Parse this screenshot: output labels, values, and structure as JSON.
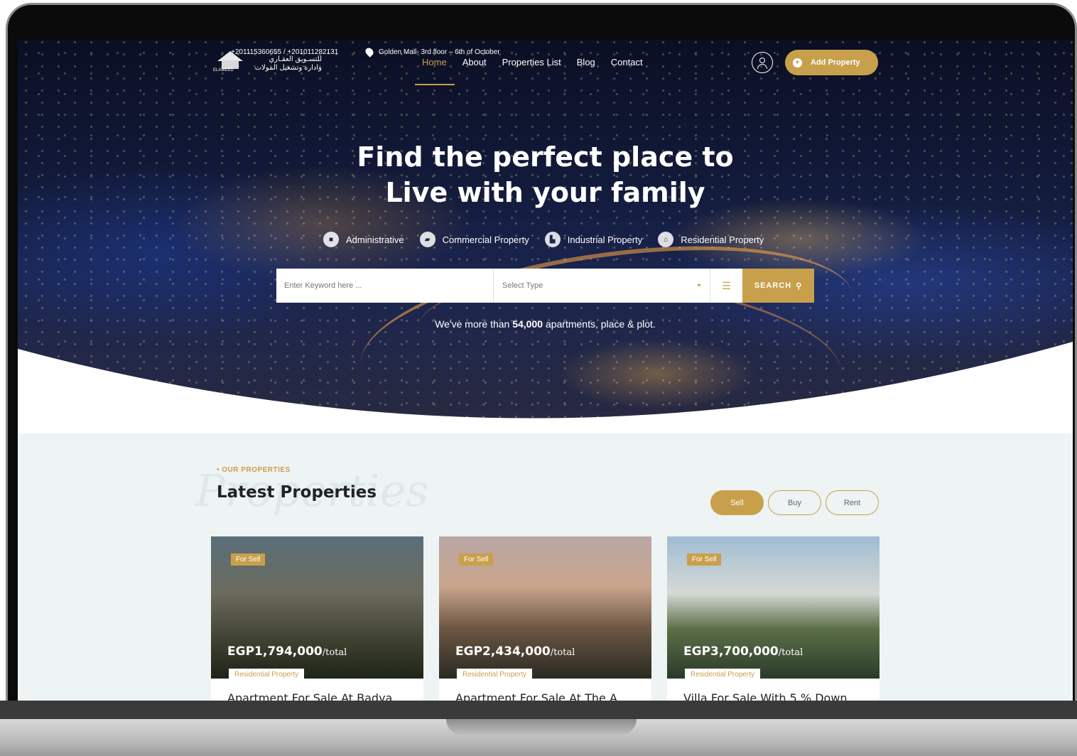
{
  "topbar": {
    "phone": "+201115360655 / +201011282131",
    "arabic_line1": "للتسـويق العقـاري",
    "arabic_line2": "وادارة وتشغيل المولات",
    "logo_text": "ELAMEED",
    "address": "Golden Mall- 3rd floor – 6th of October"
  },
  "nav": {
    "items": [
      {
        "label": "Home",
        "active": true
      },
      {
        "label": "About"
      },
      {
        "label": "Properties List"
      },
      {
        "label": "Blog"
      },
      {
        "label": "Contact"
      }
    ],
    "add_property": "Add Property"
  },
  "hero": {
    "headline_line1": "Find the perfect place to",
    "headline_line2": "Live with your family",
    "categories": [
      {
        "label": "Administrative",
        "icon": "briefcase-icon"
      },
      {
        "label": "Commercial Property",
        "icon": "cart-icon"
      },
      {
        "label": "Industrial Property",
        "icon": "factory-icon"
      },
      {
        "label": "Residential Property",
        "icon": "home-icon"
      }
    ],
    "search": {
      "keyword_placeholder": "Enter Keyword here ...",
      "type_placeholder": "Select Type",
      "button": "SEARCH"
    },
    "tagline_pre": "We've more than",
    "tagline_count": "54,000",
    "tagline_post": "apartments, place & plot."
  },
  "properties": {
    "eyebrow": "• OUR PROPERTIES",
    "ghost": "Properties",
    "title": "Latest Properties",
    "tabs": [
      "Sell",
      "Buy",
      "Rent"
    ],
    "cards": [
      {
        "badge": "For Sell",
        "price": "EGP1,794,000",
        "unit": "/total",
        "category": "Residential Property",
        "title": "Apartment For Sale At Badya ..."
      },
      {
        "badge": "For Sell",
        "price": "EGP2,434,000",
        "unit": "/total",
        "category": "Residential Property",
        "title": "Apartment For Sale At The A..."
      },
      {
        "badge": "For Sell",
        "price": "EGP3,700,000",
        "unit": "/total",
        "category": "Residential Property",
        "title": "Villa For Sale With 5 % Down..."
      }
    ]
  },
  "colors": {
    "accent": "#c8a04c",
    "dark": "#222222",
    "section_bg": "#eef3f3"
  }
}
